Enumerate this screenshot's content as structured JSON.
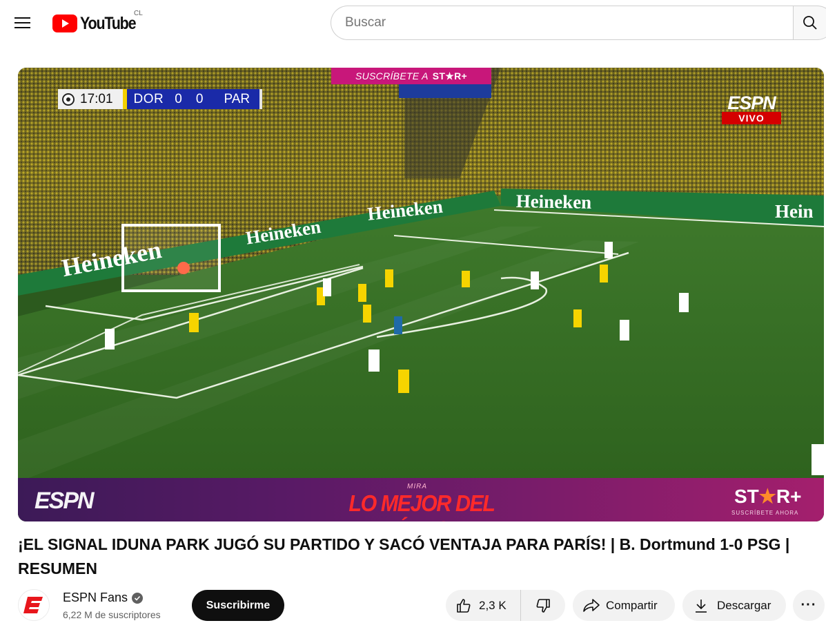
{
  "header": {
    "logo_text": "YouTube",
    "region": "CL",
    "search_placeholder": "Buscar"
  },
  "player": {
    "promo_top_prefix": "SUSCRÍBETE A",
    "promo_top_brand": "ST★R+",
    "scorebug": {
      "clock": "17:01",
      "home_team": "DOR",
      "home_score": "0",
      "away_score": "0",
      "away_team": "PAR"
    },
    "broadcaster": "ESPN",
    "live_label": "VIVO",
    "ad_boards": [
      "Heineken",
      "Heineken",
      "Heineken",
      "Heineken",
      "Hein"
    ],
    "lower_bar": {
      "espn": "ESPN",
      "mira": "MIRA",
      "slogan": "LO MEJOR DEL FÚTBOL",
      "starplus_pre": "ST",
      "starplus_star": "★",
      "starplus_post": "R+",
      "starplus_sub": "SUSCRÍBETE AHORA"
    }
  },
  "video": {
    "title": "¡EL SIGNAL IDUNA PARK JUGÓ SU PARTIDO Y SACÓ VENTAJA PARA PARÍS! | B. Dortmund 1-0 PSG | RESUMEN"
  },
  "channel": {
    "name": "ESPN Fans",
    "subscribers": "6,22 M de suscriptores",
    "subscribe_label": "Suscribirme"
  },
  "actions": {
    "likes": "2,3 K",
    "share_label": "Compartir",
    "download_label": "Descargar",
    "more_label": "···"
  },
  "colors": {
    "youtube_red": "#ff0000",
    "espn_red": "#d40000",
    "pitch_green": "#2f6a22"
  }
}
